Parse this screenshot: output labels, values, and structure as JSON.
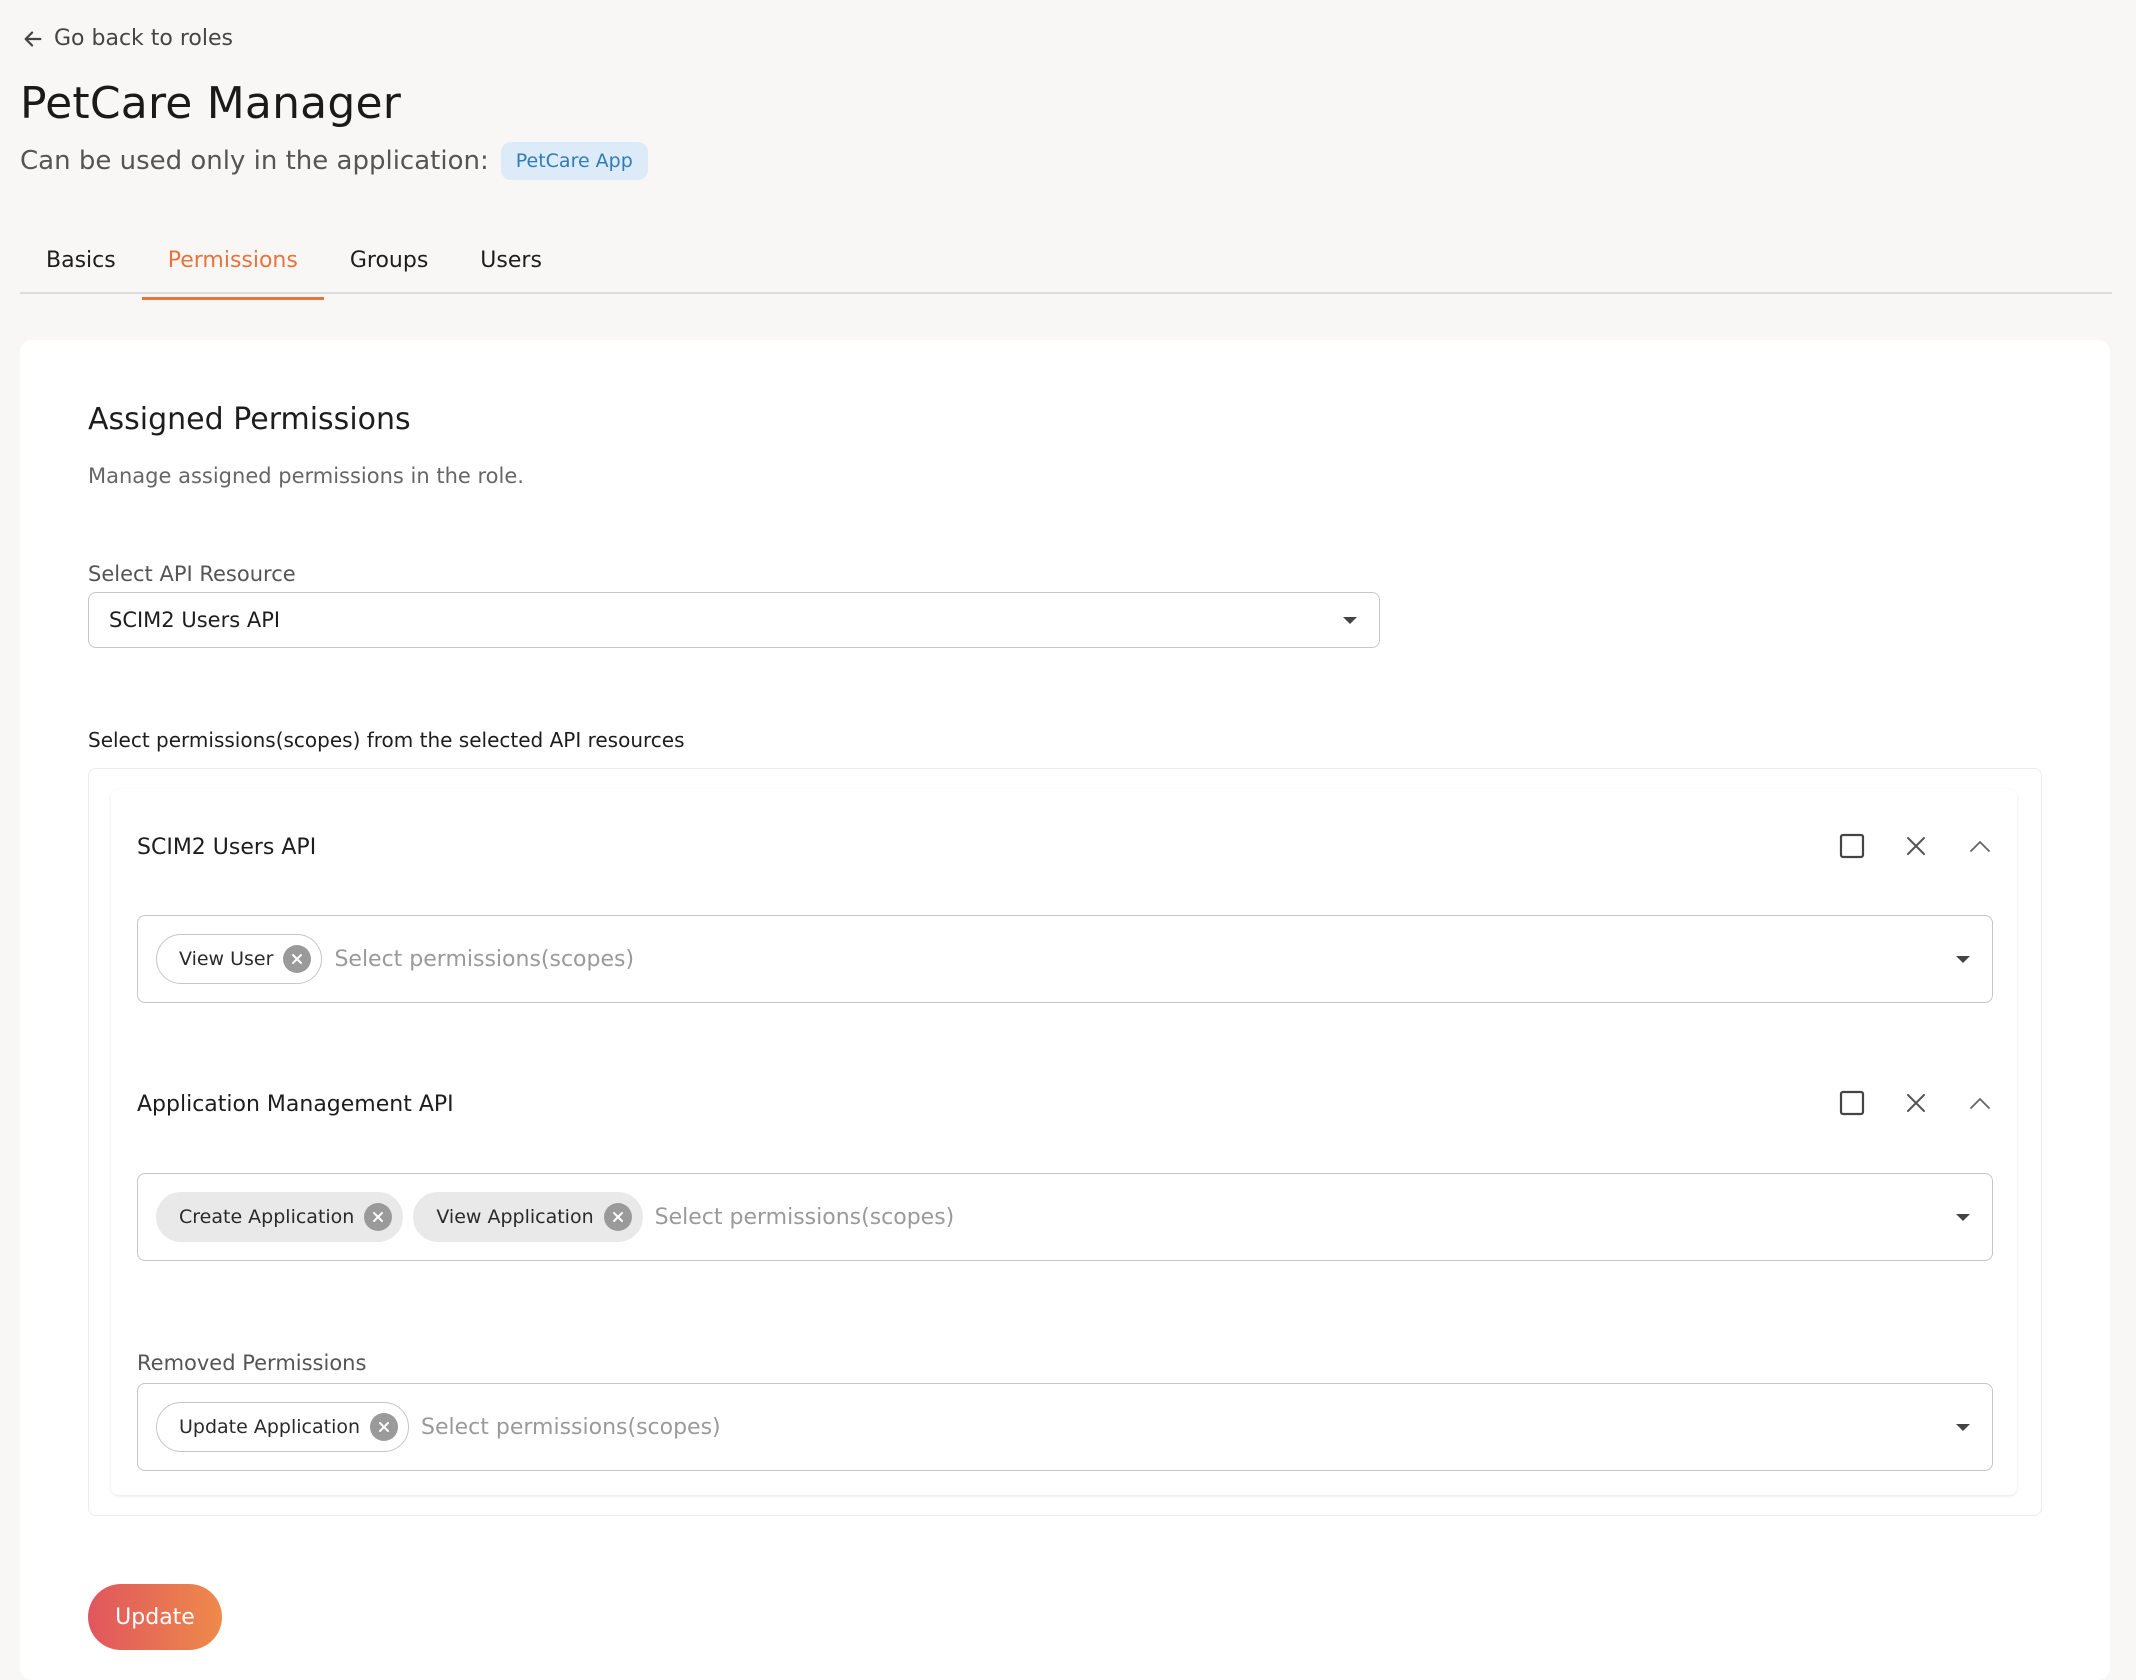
{
  "nav": {
    "back_label": "Go back to roles"
  },
  "header": {
    "title": "PetCare Manager",
    "subtitle": "Can be used only in the application:",
    "app_chip": "PetCare App"
  },
  "tabs": [
    {
      "label": "Basics",
      "active": false
    },
    {
      "label": "Permissions",
      "active": true
    },
    {
      "label": "Groups",
      "active": false
    },
    {
      "label": "Users",
      "active": false
    }
  ],
  "section": {
    "title": "Assigned Permissions",
    "description": "Manage assigned permissions in the role.",
    "resource_label": "Select API Resource",
    "resource_value": "SCIM2 Users API",
    "scopes_hint": "Select permissions(scopes) from the selected API resources"
  },
  "apis": [
    {
      "name": "SCIM2 Users API",
      "scopes": [
        "View User"
      ],
      "placeholder": "Select permissions(scopes)"
    },
    {
      "name": "Application Management API",
      "scopes": [
        "Create Application",
        "View Application"
      ],
      "placeholder": "Select permissions(scopes)"
    }
  ],
  "removed": {
    "label": "Removed Permissions",
    "scopes": [
      "Update Application"
    ],
    "placeholder": "Select permissions(scopes)"
  },
  "actions": {
    "update_label": "Update"
  },
  "colors": {
    "accent": "#e8743b",
    "chip_bg": "#dcebf7",
    "chip_text": "#2e7cb8",
    "button_gradient_start": "#e0565e",
    "button_gradient_end": "#ee8a4a"
  }
}
